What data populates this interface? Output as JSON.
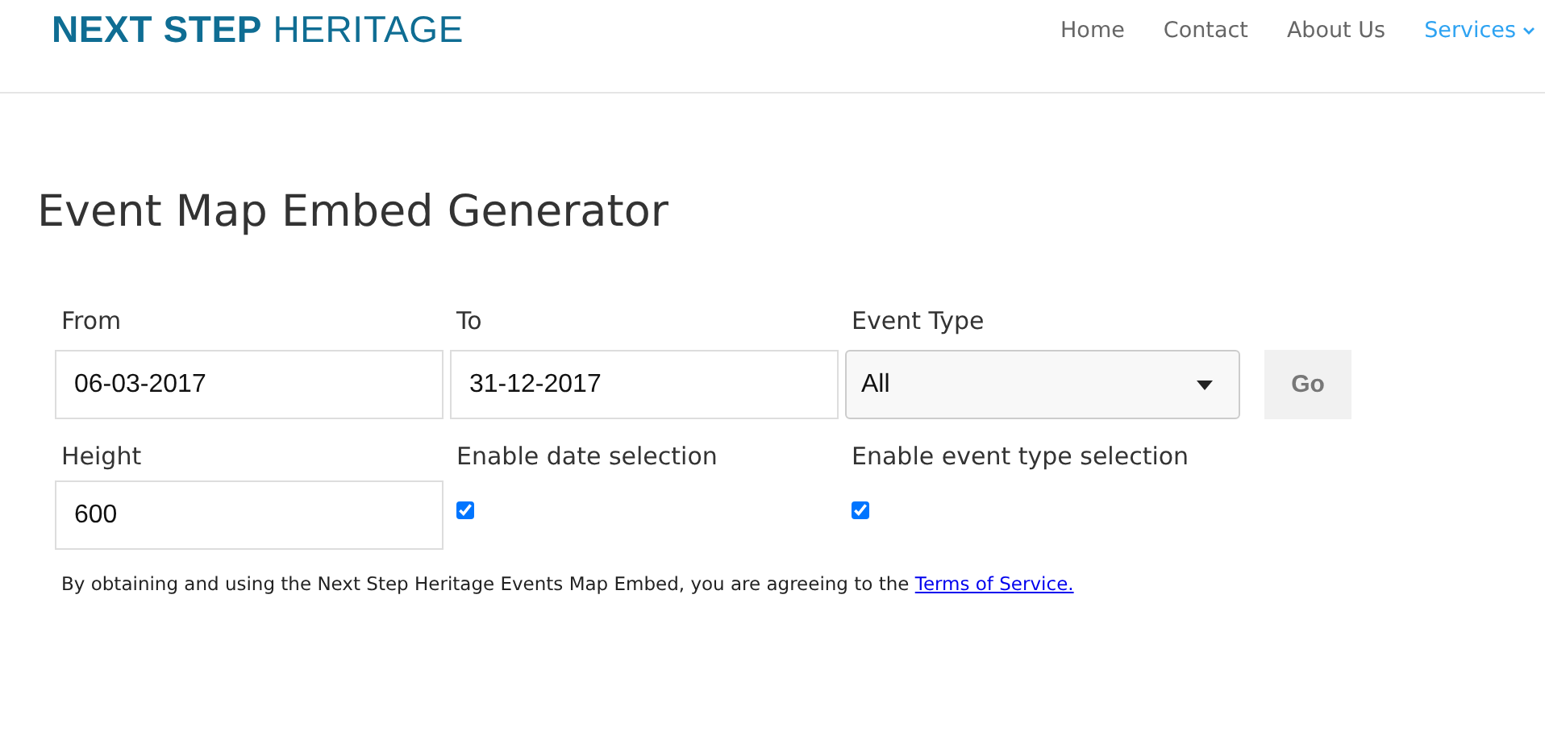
{
  "header": {
    "logo": "**NEXT STEP** HERITAGE",
    "nav": [
      {
        "label": "Home",
        "selected": false
      },
      {
        "label": "Contact",
        "selected": false
      },
      {
        "label": "About Us",
        "selected": false
      },
      {
        "label": "Services",
        "selected": true,
        "has_menu": true
      }
    ]
  },
  "page_title": "Event Map Embed Generator",
  "form": {
    "from": {
      "label": "From",
      "value": "06-03-2017"
    },
    "to": {
      "label": "To",
      "value": "31-12-2017"
    },
    "event_type": {
      "label": "Event Type",
      "value": "All"
    },
    "go_button": "Go",
    "height": {
      "label": "Height",
      "value": "600"
    },
    "options": [
      {
        "label": "Enable date selection",
        "checked": true
      },
      {
        "label": "Enable event type selection",
        "checked": true
      }
    ]
  },
  "notice": {
    "text": "By obtaining and using the Next Step Heritage Events Map Embed, you are agreeing to the ",
    "link": "Terms of Service."
  }
}
